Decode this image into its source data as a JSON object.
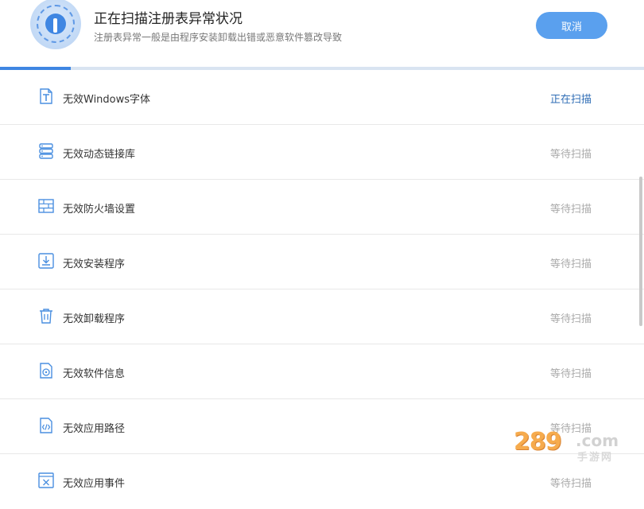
{
  "header": {
    "title": "正在扫描注册表异常状况",
    "subtitle": "注册表异常一般是由程序安装卸载出错或恶意软件篡改导致",
    "cancel_label": "取消"
  },
  "progress": {
    "fraction": 0.11
  },
  "items": [
    {
      "label": "无效Windows字体",
      "status": "正在扫描",
      "icon": "font-file-icon",
      "active": true
    },
    {
      "label": "无效动态链接库",
      "status": "等待扫描",
      "icon": "server-stack-icon",
      "active": false
    },
    {
      "label": "无效防火墙设置",
      "status": "等待扫描",
      "icon": "firewall-brick-icon",
      "active": false
    },
    {
      "label": "无效安装程序",
      "status": "等待扫描",
      "icon": "download-install-icon",
      "active": false
    },
    {
      "label": "无效卸载程序",
      "status": "等待扫描",
      "icon": "trash-icon",
      "active": false
    },
    {
      "label": "无效软件信息",
      "status": "等待扫描",
      "icon": "disc-file-icon",
      "active": false
    },
    {
      "label": "无效应用路径",
      "status": "等待扫描",
      "icon": "code-file-icon",
      "active": false
    },
    {
      "label": "无效应用事件",
      "status": "等待扫描",
      "icon": "event-window-icon",
      "active": false
    }
  ],
  "watermark": {
    "number": "289",
    "domain": ".com",
    "text": "手游网"
  },
  "colors": {
    "accent": "#3f86e2",
    "active_status": "#2f6db5",
    "waiting_status": "#aaaaaa",
    "button": "#5aa0ee"
  }
}
